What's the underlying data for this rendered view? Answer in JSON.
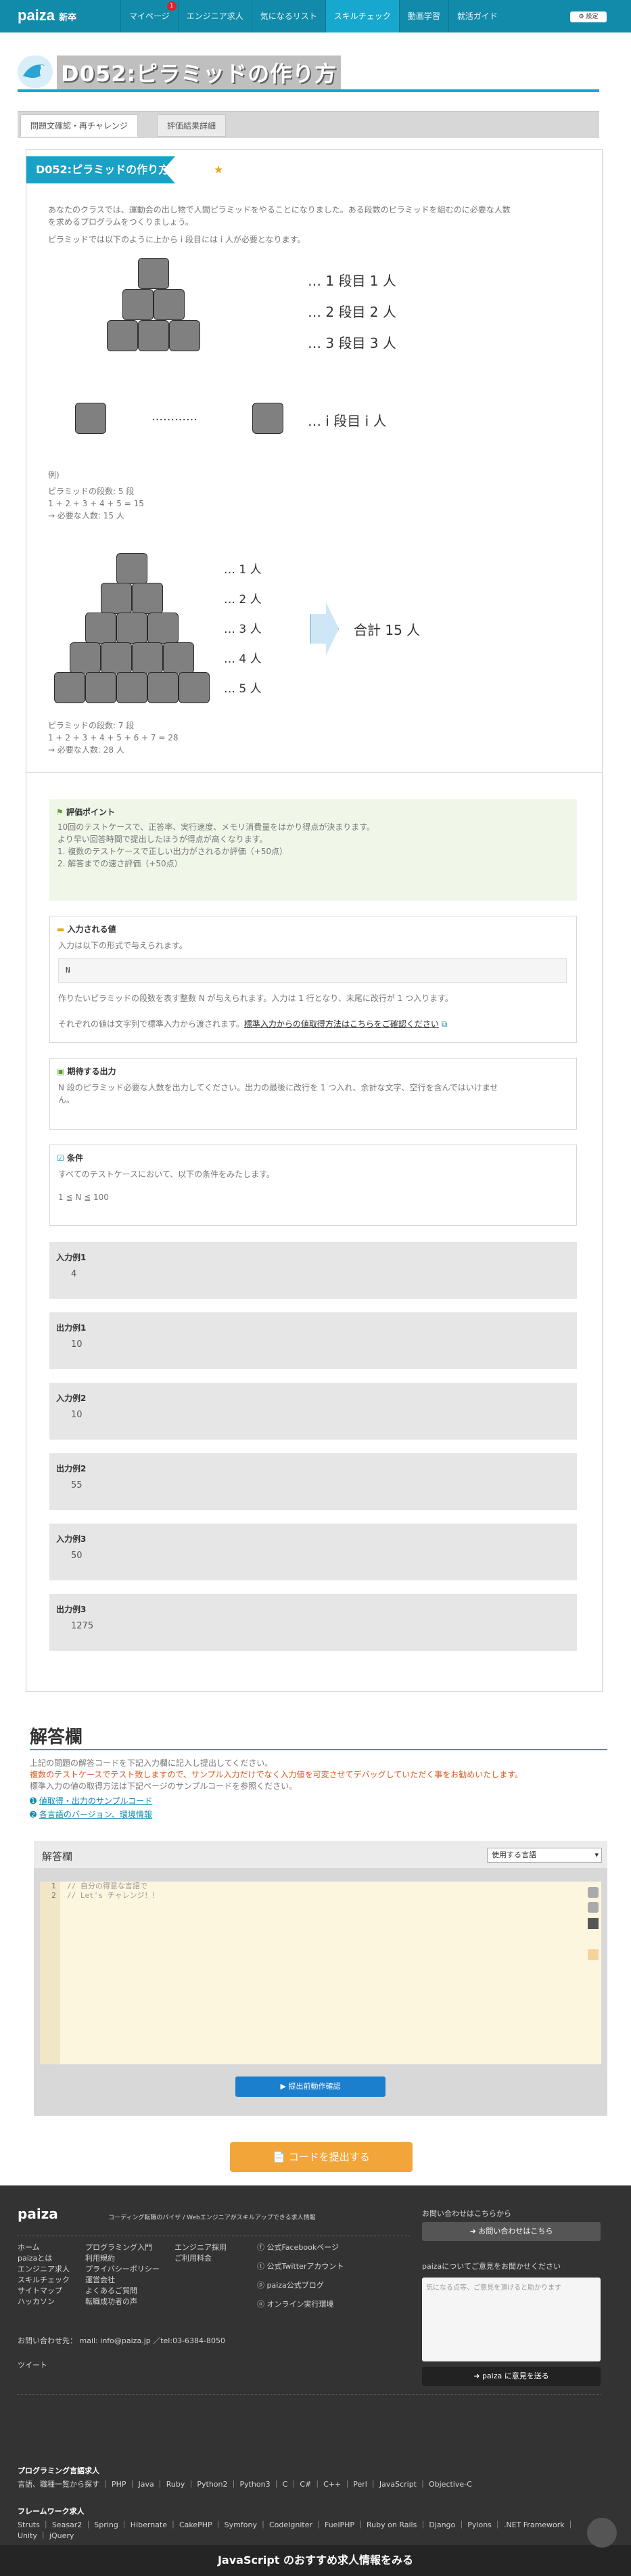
{
  "header": {
    "logo": "paiza",
    "logo_sub": "新卒",
    "nav": [
      "マイページ",
      "エンジニア求人",
      "気になるリスト",
      "スキルチェック",
      "動画学習",
      "就活ガイド"
    ],
    "badge": "1",
    "settings": "設定"
  },
  "page": {
    "title": "D052:ピラミッドの作り方"
  },
  "tabs": [
    "問題文確認・再チャレンジ",
    "評価結果詳細"
  ],
  "problem": {
    "ribbon": "D052:ピラミッドの作り方",
    "intro_1": "あなたのクラスでは、運動会の出し物で人間ピラミッドをやることになりました。ある段数のピラミッドを組むのに必要な人数",
    "intro_2": "を求めるプログラムをつくりましょう。",
    "intro_3": "ピラミッドでは以下のように上から i 段目には i 人が必要となります。",
    "fig1_labels": [
      "… 1 段目 1 人",
      "… 2 段目 2 人",
      "… 3 段目 3 人"
    ],
    "fig1_dots": "…………",
    "fig1_last": "… i 段目 i 人",
    "ex1_head": "例)",
    "ex1_lines": [
      "ピラミッドの段数: 5 段",
      "1 + 2 + 3 + 4 + 5 = 15",
      "→ 必要な人数: 15 人"
    ],
    "fig2_labels": [
      "… 1 人",
      "… 2 人",
      "… 3 人",
      "… 4 人",
      "… 5 人"
    ],
    "fig2_total": "合計 15 人",
    "ex2_lines": [
      "ピラミッドの段数: 7 段",
      "1 + 2 + 3 + 4 + 5 + 6 + 7 = 28",
      "→ 必要な人数: 28 人"
    ]
  },
  "eval": {
    "heading": "評価ポイント",
    "lines": [
      "10回のテストケースで、正答率、実行速度、メモリ消費量をはかり得点が決まります。",
      "より早い回答時間で提出したほうが得点が高くなります。",
      "1. 複数のテストケースで正しい出力がされるか評価（+50点）",
      "2. 解答までの速さ評価（+50点）"
    ]
  },
  "input_spec": {
    "heading": "入力される値",
    "line1": "入力は以下の形式で与えられます。",
    "code": "N",
    "line2": "作りたいピラミッドの段数を表す整数 N が与えられます。入力は 1 行となり、末尾に改行が 1 つ入ります。",
    "line3": "それぞれの値は文字列で標準入力から渡されます。",
    "link": "標準入力からの値取得方法はこちらをご確認ください"
  },
  "output_spec": {
    "heading": "期待する出力",
    "line1": "N 段のピラミッド必要な人数を出力してください。出力の最後に改行を 1 つ入れ、余計な文字、空行を含んではいけませ",
    "line2": "ん。"
  },
  "condition": {
    "heading": "条件",
    "line1": "すべてのテストケースにおいて、以下の条件をみたします。",
    "line2": "1 ≦ N ≦ 100"
  },
  "examples": [
    {
      "label": "入力例1",
      "value": "4"
    },
    {
      "label": "出力例1",
      "value": "10"
    },
    {
      "label": "入力例2",
      "value": "10"
    },
    {
      "label": "出力例2",
      "value": "55"
    },
    {
      "label": "入力例3",
      "value": "50"
    },
    {
      "label": "出力例3",
      "value": "1275"
    }
  ],
  "answer": {
    "heading": "解答欄",
    "line1": "上記の問題の解答コードを下記入力欄に記入し提出してください。",
    "line2": "複数のテストケースでテスト致しますので、サンプル入力だけでなく入力値を可変させてデバッグしていただく事をお勧めいたします。",
    "line3": "標準入力の値の取得方法は下記ページのサンプルコードを参照ください。",
    "link1": "値取得・出力のサンプルコード",
    "link2": "各言語のバージョン、環境情報",
    "editor_title": "解答欄",
    "lang_select": "使用する言語",
    "code_lines": [
      "// 自分の得意な言語で",
      "// Let's チャレンジ！！"
    ],
    "run_button": "提出前動作確認",
    "submit_button": "コードを提出する"
  },
  "footer": {
    "logo": "paiza",
    "tagline": "コーディング転職のパイザ / Webエンジニアがスキルアップできる求人情報",
    "col1": [
      "ホーム",
      "paizaとは",
      "エンジニア求人",
      "スキルチェック",
      "サイトマップ",
      "ハッカソン"
    ],
    "col2": [
      "プログラミング入門",
      "利用規約",
      "プライバシーポリシー",
      "運営会社",
      "よくあるご質問",
      "転職成功者の声"
    ],
    "col3": [
      "エンジニア採用",
      "ご利用料金"
    ],
    "social": [
      "公式Facebookページ",
      "公式Twitterアカウント",
      "paiza公式ブログ",
      "オンライン実行環境"
    ],
    "contact": "お問い合わせ先： mail: info@paiza.jp ／tel:03-6384-8050",
    "tweet": "ツイート",
    "inquiry_head": "お問い合わせはこちらから",
    "inquiry_button": "お問い合わせはこちら",
    "opinion_head": "paizaについてご意見をお聞かせください",
    "opinion_placeholder": "気になる点等、ご意見を頂けると助かります",
    "opinion_button": "paiza に意見を送る",
    "lang_head": "プログラミング言語求人",
    "langs": "言語、職種一覧から探す ｜ PHP ｜ Java ｜ Ruby ｜ Python2 ｜ Python3 ｜ C ｜ C# ｜ C++ ｜ Perl ｜ JavaScript ｜ Objective-C",
    "fw_head": "フレームワーク求人",
    "fw": "Struts ｜ Seasar2 ｜ Spring ｜ Hibernate ｜ CakePHP ｜ Symfony ｜ CodeIgniter ｜ FuelPHP ｜ Ruby on Rails ｜ Django ｜ Pylons ｜ .NET Framework ｜ Unity ｜ jQuery",
    "js_bar": "JavaScript のおすすめ求人情報をみる"
  }
}
